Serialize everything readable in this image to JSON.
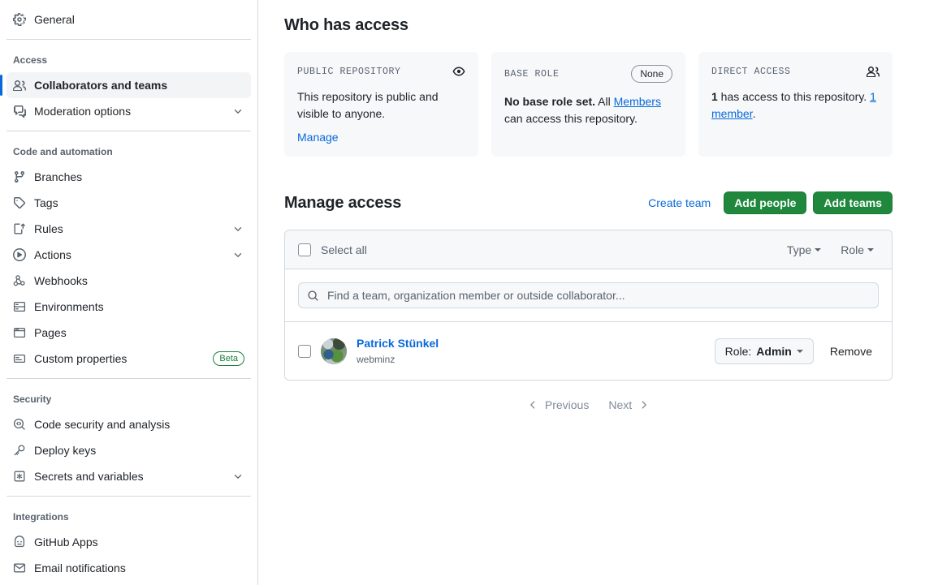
{
  "sidebar": {
    "top_items": [
      {
        "label": "General",
        "icon": "gear-icon",
        "name": "general"
      }
    ],
    "sections": [
      {
        "heading": "Access",
        "items": [
          {
            "label": "Collaborators and teams",
            "icon": "people-icon",
            "name": "collaborators-and-teams",
            "selected": true,
            "chevron": false
          },
          {
            "label": "Moderation options",
            "icon": "comment-discussion-icon",
            "name": "moderation-options",
            "selected": false,
            "chevron": true
          }
        ]
      },
      {
        "heading": "Code and automation",
        "items": [
          {
            "label": "Branches",
            "icon": "git-branch-icon",
            "name": "branches",
            "selected": false,
            "chevron": false
          },
          {
            "label": "Tags",
            "icon": "tag-icon",
            "name": "tags",
            "selected": false,
            "chevron": false
          },
          {
            "label": "Rules",
            "icon": "rules-icon",
            "name": "rules",
            "selected": false,
            "chevron": true
          },
          {
            "label": "Actions",
            "icon": "play-icon",
            "name": "actions",
            "selected": false,
            "chevron": true
          },
          {
            "label": "Webhooks",
            "icon": "webhook-icon",
            "name": "webhooks",
            "selected": false,
            "chevron": false
          },
          {
            "label": "Environments",
            "icon": "server-icon",
            "name": "environments",
            "selected": false,
            "chevron": false
          },
          {
            "label": "Pages",
            "icon": "browser-icon",
            "name": "pages",
            "selected": false,
            "chevron": false
          },
          {
            "label": "Custom properties",
            "icon": "note-icon",
            "name": "custom-properties",
            "selected": false,
            "chevron": false,
            "badge": "Beta"
          }
        ]
      },
      {
        "heading": "Security",
        "items": [
          {
            "label": "Code security and analysis",
            "icon": "codescan-icon",
            "name": "code-security-and-analysis",
            "selected": false,
            "chevron": false
          },
          {
            "label": "Deploy keys",
            "icon": "key-icon",
            "name": "deploy-keys",
            "selected": false,
            "chevron": false
          },
          {
            "label": "Secrets and variables",
            "icon": "secret-icon",
            "name": "secrets-and-variables",
            "selected": false,
            "chevron": true
          }
        ]
      },
      {
        "heading": "Integrations",
        "items": [
          {
            "label": "GitHub Apps",
            "icon": "app-icon",
            "name": "github-apps",
            "selected": false,
            "chevron": false
          },
          {
            "label": "Email notifications",
            "icon": "mail-icon",
            "name": "email-notifications",
            "selected": false,
            "chevron": false
          }
        ]
      }
    ]
  },
  "who_has_access": {
    "title": "Who has access",
    "cards": [
      {
        "kicker": "PUBLIC REPOSITORY",
        "icon": "eye-icon",
        "body_text": "This repository is public and visible to anyone.",
        "link": "Manage"
      },
      {
        "kicker": "BASE ROLE",
        "badge": "None",
        "body_bold": "No base role set.",
        "body_pre_link": " All ",
        "body_link": "Members",
        "body_post_link": " can access this repository."
      },
      {
        "kicker": "DIRECT ACCESS",
        "icon": "people-icon",
        "body_bold": "1",
        "body_text": " has access to this repository. ",
        "body_link": "1 member",
        "body_suffix": "."
      }
    ]
  },
  "manage_access": {
    "title": "Manage access",
    "create_team_label": "Create team",
    "add_people_label": "Add people",
    "add_teams_label": "Add teams",
    "accent_green": "#1f883d",
    "accent_blue": "#0969da",
    "select_all_label": "Select all",
    "type_filter_label": "Type",
    "role_filter_label": "Role",
    "search_placeholder": "Find a team, organization member or outside collaborator...",
    "search_value": "",
    "members": [
      {
        "name": "Patrick Stünkel",
        "login": "webminz",
        "role_prefix": "Role:",
        "role_value": "Admin",
        "remove_label": "Remove"
      }
    ],
    "pagination": {
      "previous_label": "Previous",
      "next_label": "Next"
    }
  }
}
